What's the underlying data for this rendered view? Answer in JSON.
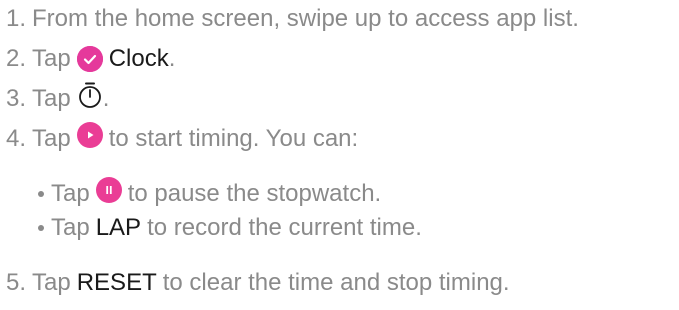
{
  "steps": [
    {
      "num": "1.",
      "text": "From the home screen, swipe up to access app list."
    },
    {
      "num": "2.",
      "pre": "Tap",
      "bold": "Clock",
      "post": "."
    },
    {
      "num": "3.",
      "pre": "Tap",
      "post": "."
    },
    {
      "num": "4.",
      "pre": "Tap",
      "post": "to start timing. You can:"
    },
    {
      "num": "5.",
      "pre": "Tap",
      "bold": "RESET",
      "post": "to clear the time and stop timing."
    }
  ],
  "sub_steps": [
    {
      "pre": "Tap",
      "post": "to pause the stopwatch."
    },
    {
      "pre": "Tap",
      "bold": "LAP",
      "post": "to record the current time."
    }
  ],
  "icons": {
    "clock_app": "clock-app-icon",
    "stopwatch": "stopwatch-icon",
    "play": "play-icon",
    "pause": "pause-icon"
  },
  "colors": {
    "accent": "#ea3d95",
    "text": "#8a8a8a",
    "strong": "#1a1a1a"
  }
}
